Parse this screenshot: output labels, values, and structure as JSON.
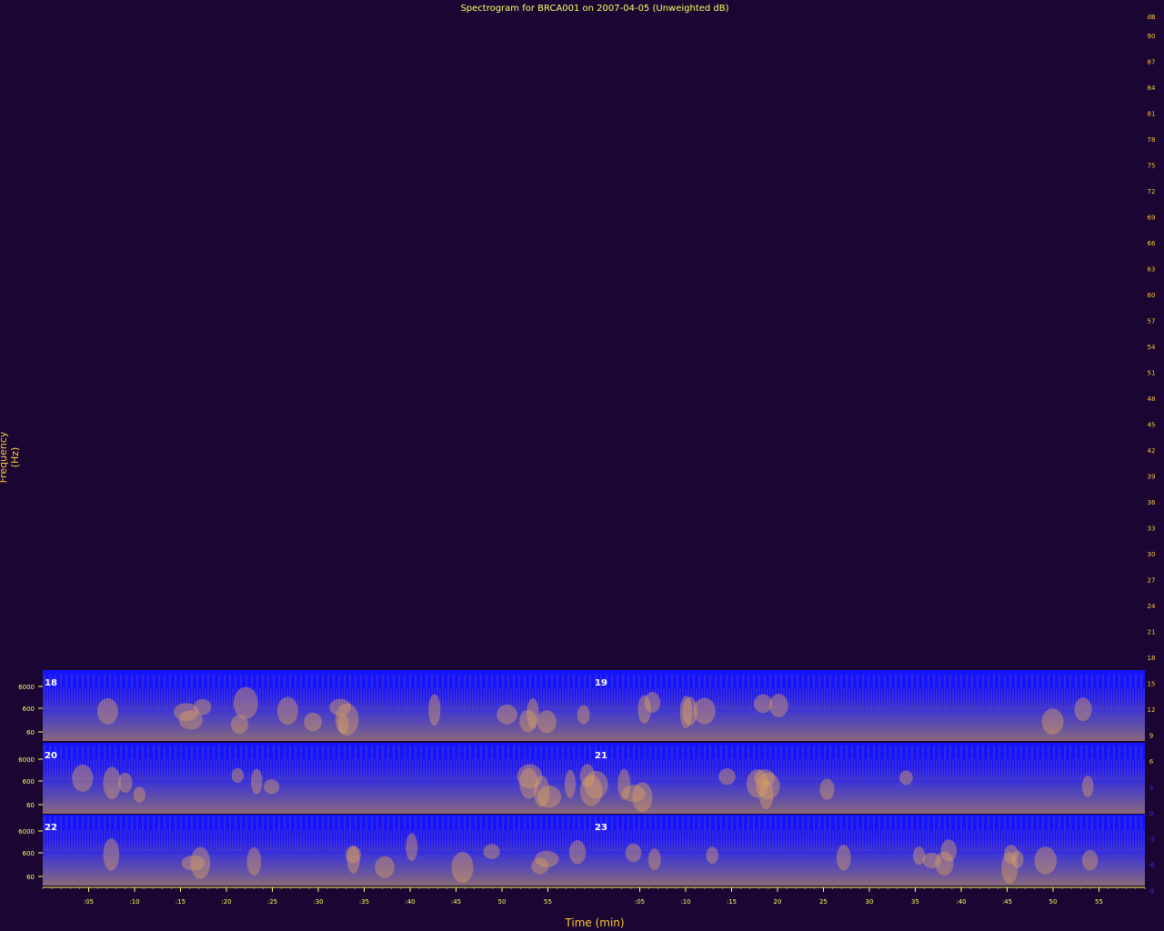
{
  "chart_data": {
    "type": "heatmap",
    "title": "Spectrogram for BRCA001 on 2007-04-05 (Unweighted dB)",
    "xlabel": "Time (min)",
    "ylabel": "Frequency (Hz)",
    "frequency_ticks": [
      "6000",
      "600",
      "60"
    ],
    "time_ticks": [
      ":05",
      ":10",
      ":15",
      ":20",
      ":25",
      ":30",
      ":35",
      ":40",
      ":45",
      "50",
      "55",
      ":05",
      ":10",
      ":15",
      "20",
      "25",
      "30",
      "35",
      ":40",
      ":45",
      "50",
      "55"
    ],
    "colorbar": {
      "unit": "dB",
      "ticks": [
        90,
        87,
        84,
        81,
        78,
        75,
        72,
        69,
        66,
        63,
        60,
        57,
        54,
        51,
        48,
        45,
        42,
        39,
        36,
        33,
        30,
        27,
        24,
        21,
        18,
        15,
        12,
        9,
        6,
        3,
        0,
        -3,
        -6,
        -9
      ]
    },
    "rows": [
      {
        "hour_labels": [
          "18",
          "19"
        ]
      },
      {
        "hour_labels": [
          "20",
          "21"
        ]
      },
      {
        "hour_labels": [
          "22",
          "23"
        ]
      }
    ]
  }
}
